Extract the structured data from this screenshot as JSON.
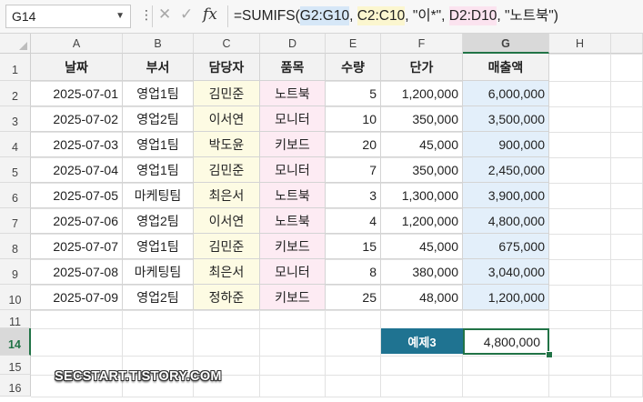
{
  "name_box": {
    "value": "G14"
  },
  "formula_bar": {
    "prefix": "=SUMIFS(",
    "range_sum": "G2:G10",
    "sep1": ", ",
    "range_crit1": "C2:C10",
    "mid": ", \"이*\", ",
    "range_crit2": "D2:D10",
    "suffix": ", \"노트북\")"
  },
  "columns": [
    "A",
    "B",
    "C",
    "D",
    "E",
    "F",
    "G",
    "H"
  ],
  "rows": [
    "1",
    "2",
    "3",
    "4",
    "5",
    "6",
    "7",
    "8",
    "9",
    "10",
    "11",
    "14",
    "15",
    "16"
  ],
  "table": {
    "headers": [
      "날짜",
      "부서",
      "담당자",
      "품목",
      "수량",
      "단가",
      "매출액"
    ],
    "rows": [
      [
        "2025-07-01",
        "영업1팀",
        "김민준",
        "노트북",
        "5",
        "1,200,000",
        "6,000,000"
      ],
      [
        "2025-07-02",
        "영업2팀",
        "이서연",
        "모니터",
        "10",
        "350,000",
        "3,500,000"
      ],
      [
        "2025-07-03",
        "영업1팀",
        "박도윤",
        "키보드",
        "20",
        "45,000",
        "900,000"
      ],
      [
        "2025-07-04",
        "영업1팀",
        "김민준",
        "모니터",
        "7",
        "350,000",
        "2,450,000"
      ],
      [
        "2025-07-05",
        "마케팅팀",
        "최은서",
        "노트북",
        "3",
        "1,300,000",
        "3,900,000"
      ],
      [
        "2025-07-06",
        "영업2팀",
        "이서연",
        "노트북",
        "4",
        "1,200,000",
        "4,800,000"
      ],
      [
        "2025-07-07",
        "영업1팀",
        "김민준",
        "키보드",
        "15",
        "45,000",
        "675,000"
      ],
      [
        "2025-07-08",
        "마케팅팀",
        "최은서",
        "모니터",
        "8",
        "380,000",
        "3,040,000"
      ],
      [
        "2025-07-09",
        "영업2팀",
        "정하준",
        "키보드",
        "25",
        "48,000",
        "1,200,000"
      ]
    ]
  },
  "example": {
    "label": "예제3",
    "result": "4,800,000"
  },
  "watermark": "SECSTART.TISTORY.COM",
  "colors": {
    "label_bg": "#1f7391",
    "selection": "#217346",
    "manager_fill": "#fdfbe3",
    "item_fill": "#fdebf3",
    "sales_fill": "#e3effa"
  },
  "icons": [
    "chevron-down-icon",
    "more-vert-icon",
    "cancel-icon",
    "enter-icon",
    "function-icon"
  ]
}
